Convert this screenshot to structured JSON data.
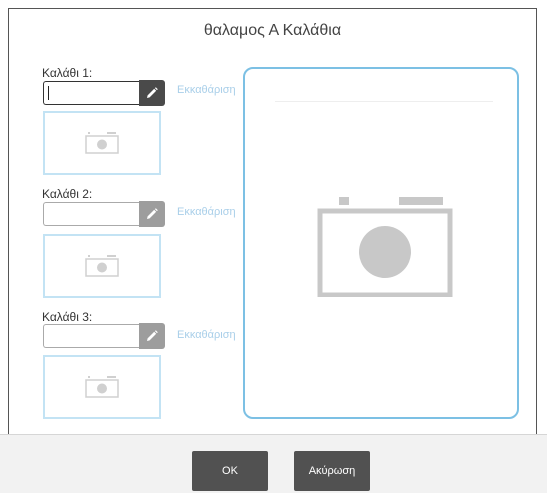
{
  "dialog": {
    "title": "θαλαμος Α Καλάθια"
  },
  "baskets": [
    {
      "label": "Καλάθι 1:",
      "value": "",
      "clear_label": "Εκκαθάριση",
      "edit_icon": "pencil-icon",
      "state": "active"
    },
    {
      "label": "Καλάθι 2:",
      "value": "",
      "clear_label": "Εκκαθάριση",
      "edit_icon": "pencil-icon",
      "state": "inactive"
    },
    {
      "label": "Καλάθι 3:",
      "value": "",
      "clear_label": "Εκκαθάριση",
      "edit_icon": "pencil-icon",
      "state": "inactive"
    }
  ],
  "thumbnail_icon": "camera-icon",
  "preview_icon": "camera-icon",
  "footer": {
    "ok_label": "OK",
    "cancel_label": "Ακύρωση"
  },
  "colors": {
    "accent_border": "#7cc0e4",
    "thumb_border": "#c3e3f4",
    "clear_link": "#a9cfe9",
    "button_bg": "#515151",
    "edit_active": "#4a4a4a",
    "edit_inactive": "#9d9d9d",
    "camera_gray": "#c8c8c8"
  }
}
